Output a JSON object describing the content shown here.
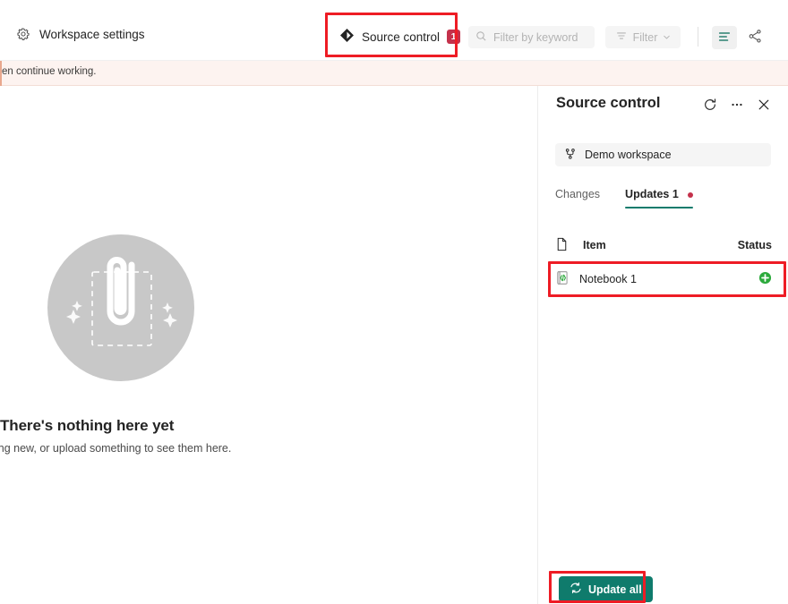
{
  "toolbar": {
    "workspace_settings_label": "Workspace settings",
    "gear_icon": "gear-icon",
    "source_control_label": "Source control",
    "source_control_badge": "1",
    "source_control_icon": "source-control-diamond-icon",
    "filter_placeholder": "Filter by keyword",
    "filter_value": "",
    "search_icon": "search-icon",
    "filter_button_label": "Filter",
    "filter_button_icon": "filter-lines-icon",
    "chevron_icon": "chevron-down-icon",
    "list_view_icon": "list-view-icon",
    "lineage_icon": "lineage-share-icon",
    "accent_green": "#0f7b6c",
    "badge_red": "#c4314b"
  },
  "banner": {
    "text": "en continue working."
  },
  "main": {
    "empty_state": {
      "title": "There's nothing here yet",
      "subtitle": "ing new, or upload something to see them here.",
      "illustration_icon": "paperclip-upload-illustration"
    }
  },
  "panel": {
    "title": "Source control",
    "refresh_icon": "refresh-icon",
    "more_icon": "more-options-icon",
    "close_icon": "close-icon",
    "workspace_chip": {
      "label": "Demo workspace",
      "icon": "branch-icon"
    },
    "tabs": [
      {
        "label": "Changes",
        "active": false
      },
      {
        "label": "Updates 1",
        "active": true,
        "dot": true
      }
    ],
    "table": {
      "header_icon": "document-icon",
      "columns": [
        "Item",
        "Status"
      ],
      "rows": [
        {
          "icon": "notebook-code-icon",
          "name": "Notebook 1",
          "status_icon": "added-plus-icon",
          "status_color": "#2caa3c"
        }
      ]
    },
    "update_all_label": "Update all",
    "update_all_icon": "sync-icon"
  },
  "annotations": {
    "source_control_box": "highlight-source-control",
    "notebook_row_box": "highlight-notebook-row",
    "update_all_box": "highlight-update-all",
    "color": "#ee1c25"
  }
}
